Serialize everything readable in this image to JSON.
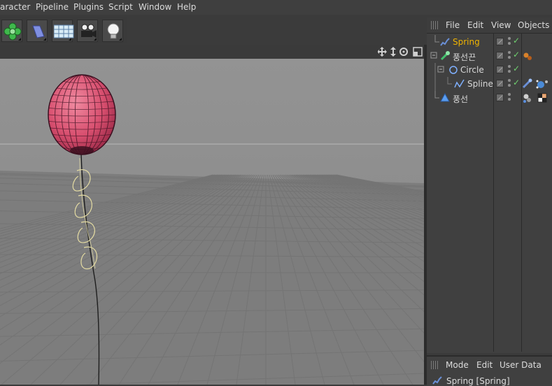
{
  "menubar": {
    "items": [
      "aracter",
      "Pipeline",
      "Plugins",
      "Script",
      "Window",
      "Help"
    ]
  },
  "toolbar": {
    "buttons": [
      {
        "icon": "deformer-flower-icon"
      },
      {
        "icon": "environment-icon"
      },
      {
        "icon": "floor-grid-icon"
      },
      {
        "icon": "camera-icon"
      },
      {
        "icon": "light-bulb-icon"
      }
    ]
  },
  "viewport": {
    "nav_icons": [
      "move-icon",
      "zoom-icon",
      "rotate-icon",
      "maximize-icon"
    ]
  },
  "object_manager": {
    "menu": [
      "File",
      "Edit",
      "View",
      "Objects"
    ],
    "objects": [
      {
        "name": "Spring",
        "icon": "spring-icon",
        "selected": true,
        "indent": 0
      },
      {
        "name": "풍선끈",
        "icon": "sweep-icon",
        "selected": false,
        "indent": 0
      },
      {
        "name": "Circle",
        "icon": "circle-spline-icon",
        "selected": false,
        "indent": 1
      },
      {
        "name": "Spline",
        "icon": "spline-icon",
        "selected": false,
        "indent": 2
      },
      {
        "name": "풍선",
        "icon": "sphere-icon",
        "selected": false,
        "indent": 0
      }
    ],
    "selected_color": "#f0b400"
  },
  "attribute_manager": {
    "menu": [
      "Mode",
      "Edit",
      "User Data"
    ],
    "title": "Spring [Spring]"
  }
}
